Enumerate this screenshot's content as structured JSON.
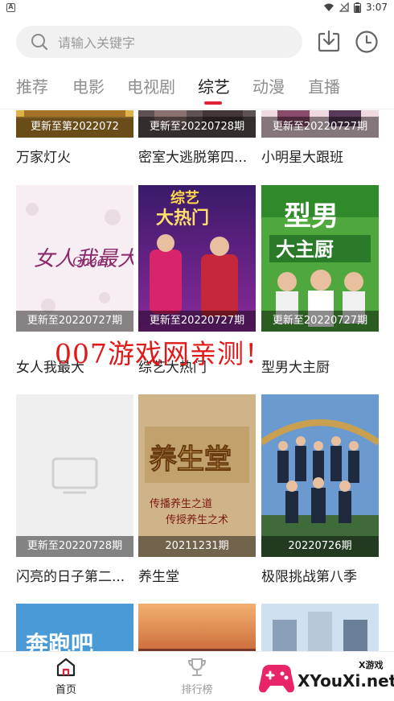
{
  "status_bar": {
    "time": "3:07",
    "app_icon": "A"
  },
  "search": {
    "placeholder": "请输入关键字",
    "icon": "search-icon"
  },
  "top_actions": [
    {
      "name": "download-icon"
    },
    {
      "name": "history-clock-icon"
    }
  ],
  "tabs": [
    {
      "label": "推荐"
    },
    {
      "label": "电影"
    },
    {
      "label": "电视剧"
    },
    {
      "label": "综艺",
      "active": true
    },
    {
      "label": "动漫"
    },
    {
      "label": "直播"
    }
  ],
  "accent_color": "#e0223a",
  "rows": [
    [
      {
        "title": "万家灯火",
        "caption": "更新至第2022072",
        "color": "#b07a1e"
      },
      {
        "title": "密室大逃脱第四...",
        "caption": "更新至20220728期",
        "color": "#6a5a5a"
      },
      {
        "title": "小明星大跟班",
        "caption": "更新至20220727期",
        "color": "#8a4a6a"
      }
    ],
    [
      {
        "title": "女人我最大",
        "caption": "更新至20220727期",
        "color": "#f3e6ee"
      },
      {
        "title": "综艺大热门",
        "caption": "更新至20220727期",
        "color": "#5a2a8a"
      },
      {
        "title": "型男大主厨",
        "caption": "更新至20220727期",
        "color": "#3f9a3a"
      }
    ],
    [
      {
        "title": "闪亮的日子第二...",
        "caption": "更新至20220728期",
        "color": "#efefef"
      },
      {
        "title": "养生堂",
        "caption": "20211231期",
        "color": "#c8ab80"
      },
      {
        "title": "极限挑战第八季",
        "caption": "20220726期",
        "color": "#5c87b8"
      }
    ],
    [
      {
        "title": "",
        "caption": "",
        "color": "#4a9ad8"
      },
      {
        "title": "",
        "caption": "",
        "color": "#d88a4a"
      },
      {
        "title": "",
        "caption": "",
        "color": "#a8c8e8"
      }
    ]
  ],
  "poster_texts": {
    "queen": "女人我最大",
    "queen_en": "Queen",
    "variety": "综艺",
    "variety_sub": "大热门",
    "chef_top": "型男",
    "chef_bottom": "大主厨",
    "health": "养生堂",
    "health_sub1": "传播养生之道",
    "health_sub2": "传授养生之术",
    "run": "奔跑吧"
  },
  "watermark": "007游戏网亲测！",
  "bottom_nav": [
    {
      "label": "首页",
      "icon": "home-icon",
      "active": true
    },
    {
      "label": "排行榜",
      "icon": "trophy-icon",
      "active": false
    }
  ],
  "logo": {
    "text": "XYouXi.net",
    "sub": "X游戏"
  }
}
